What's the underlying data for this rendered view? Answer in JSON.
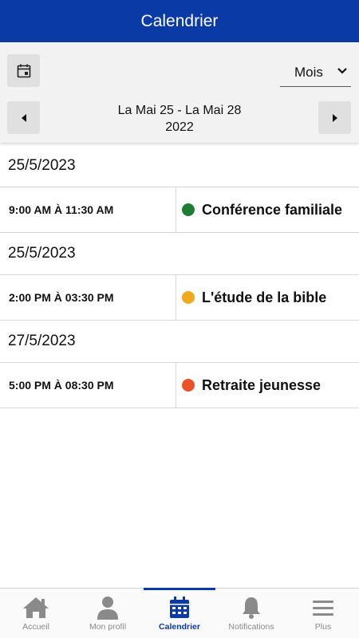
{
  "header": {
    "title": "Calendrier"
  },
  "toolbar": {
    "calendar_icon": "calendar-today-icon",
    "view_select": {
      "selected": "Mois"
    }
  },
  "range": {
    "line1": "La Mai 25 - La Mai 28",
    "line2": "2022"
  },
  "agenda": [
    {
      "date": "25/5/2023",
      "time": "9:00 AM À 11:30 AM",
      "title": "Conférence familiale",
      "color": "#1e7d32"
    },
    {
      "date": "25/5/2023",
      "time": "2:00 PM À 03:30 PM",
      "title": "L'étude de la bible",
      "color": "#f0a81e"
    },
    {
      "date": "27/5/2023",
      "time": "5:00 PM À 08:30 PM",
      "title": "Retraite jeunesse",
      "color": "#ec5228"
    }
  ],
  "tabs": [
    {
      "label": "Accueil",
      "icon": "home-icon"
    },
    {
      "label": "Mon profil",
      "icon": "person-icon"
    },
    {
      "label": "Calendrier",
      "icon": "calendar-icon",
      "active": true
    },
    {
      "label": "Notifications",
      "icon": "bell-icon"
    },
    {
      "label": "Plus",
      "icon": "menu-icon"
    }
  ],
  "colors": {
    "primary": "#0a3aa6",
    "inactive_tab": "#8a8a8a"
  }
}
